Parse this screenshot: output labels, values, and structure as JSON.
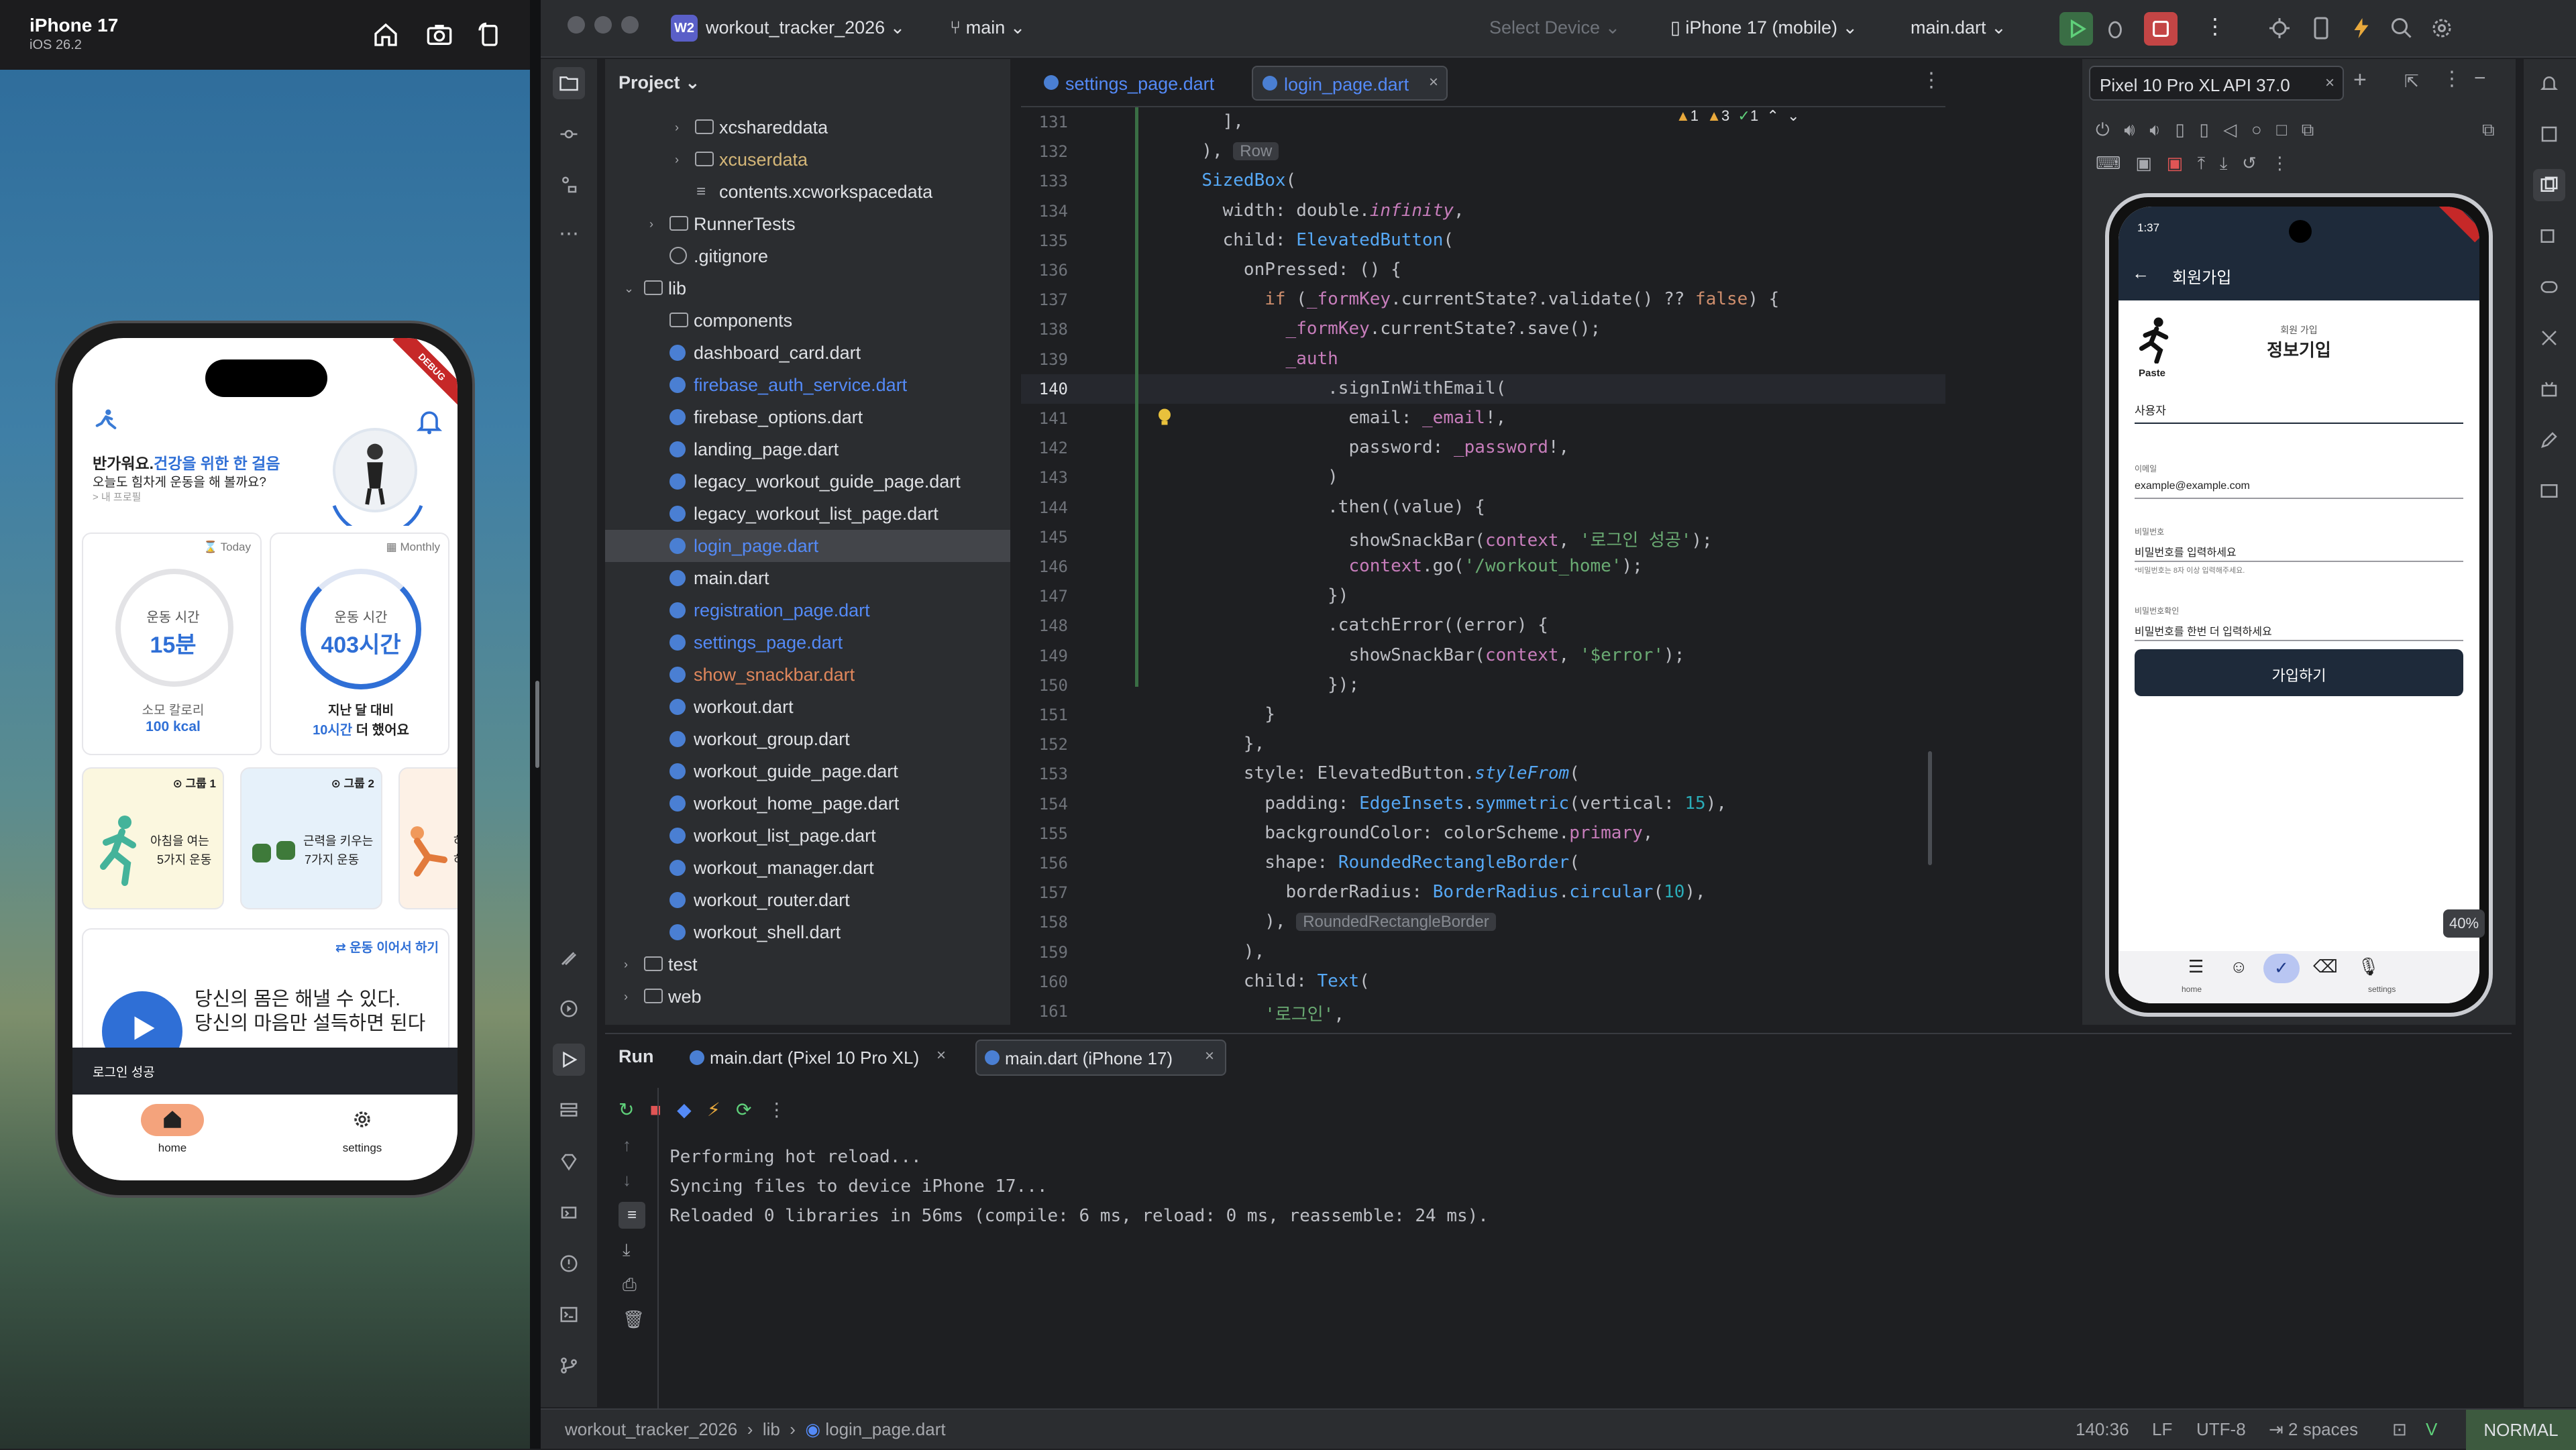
{
  "simulator": {
    "device_name": "iPhone 17",
    "os_version": "iOS 26.2",
    "buttons": [
      "home-icon",
      "screenshot-icon",
      "rotate-icon"
    ],
    "app": {
      "debug_ribbon": "DEBUG",
      "greeting_prefix": "반가워요.",
      "greeting_highlight": "건강을 위한 한 걸음",
      "greeting_sub": "오늘도 힘차게 운동을 해 볼까요?",
      "profile_link": "> 내 프로필",
      "today_card": {
        "tag": "Today",
        "ring_label": "운동 시간",
        "ring_value": "15분",
        "caption": "소모 칼로리",
        "caption_value": "100 kcal"
      },
      "monthly_card": {
        "tag": "Monthly",
        "ring_label": "운동 시간",
        "ring_value": "403시간",
        "caption": "지난 달 대비",
        "caption_value_highlight": "10시간",
        "caption_value_rest": "더 했어요"
      },
      "groups": [
        {
          "title": "그룹 1",
          "line1": "아침을 여는",
          "line2": "5가지 운동"
        },
        {
          "title": "그룹 2",
          "line1": "근력을 키우는",
          "line2": "7가지 운동"
        },
        {
          "title": "",
          "line1": "하",
          "line2": "하"
        }
      ],
      "continue_link": "운동 이어서 하기",
      "quote_line1": "당신의 몸은 해낼 수 있다.",
      "quote_line2": "당신의 마음만 설득하면 된다",
      "snackbar": "로그인 성공",
      "nav": [
        {
          "label": "home",
          "icon": "home-icon"
        },
        {
          "label": "settings",
          "icon": "gear-icon"
        }
      ]
    }
  },
  "ide": {
    "project_badge": "W2",
    "project_name": "workout_tracker_2026",
    "branch": "main",
    "select_device": "Select Device",
    "device": "iPhone 17 (mobile)",
    "run_config": "main.dart",
    "project_panel_title": "Project",
    "tree": [
      {
        "label": "xcshareddata",
        "kind": "folder",
        "depth": 3,
        "color": "#dfe1e5",
        "chev": "›"
      },
      {
        "label": "xcuserdata",
        "kind": "folder",
        "depth": 3,
        "color": "#d5b778",
        "chev": "›"
      },
      {
        "label": "contents.xcworkspacedata",
        "kind": "doc",
        "depth": 3,
        "color": "#dfe1e5",
        "chev": ""
      },
      {
        "label": "RunnerTests",
        "kind": "folder",
        "depth": 2,
        "color": "#dfe1e5",
        "chev": "›"
      },
      {
        "label": ".gitignore",
        "kind": "ignore",
        "depth": 2,
        "color": "#dfe1e5",
        "chev": ""
      },
      {
        "label": "lib",
        "kind": "folder",
        "depth": 1,
        "color": "#dfe1e5",
        "chev": "⌄"
      },
      {
        "label": "components",
        "kind": "folder",
        "depth": 2,
        "color": "#dfe1e5",
        "chev": ""
      },
      {
        "label": "dashboard_card.dart",
        "kind": "dart",
        "depth": 2,
        "color": "#dfe1e5",
        "chev": ""
      },
      {
        "label": "firebase_auth_service.dart",
        "kind": "dart",
        "depth": 2,
        "color": "#548af7",
        "chev": ""
      },
      {
        "label": "firebase_options.dart",
        "kind": "dart",
        "depth": 2,
        "color": "#dfe1e5",
        "chev": ""
      },
      {
        "label": "landing_page.dart",
        "kind": "dart",
        "depth": 2,
        "color": "#dfe1e5",
        "chev": ""
      },
      {
        "label": "legacy_workout_guide_page.dart",
        "kind": "dart",
        "depth": 2,
        "color": "#dfe1e5",
        "chev": ""
      },
      {
        "label": "legacy_workout_list_page.dart",
        "kind": "dart",
        "depth": 2,
        "color": "#dfe1e5",
        "chev": ""
      },
      {
        "label": "login_page.dart",
        "kind": "dart",
        "depth": 2,
        "color": "#548af7",
        "chev": "",
        "selected": true
      },
      {
        "label": "main.dart",
        "kind": "dart",
        "depth": 2,
        "color": "#dfe1e5",
        "chev": ""
      },
      {
        "label": "registration_page.dart",
        "kind": "dart",
        "depth": 2,
        "color": "#548af7",
        "chev": ""
      },
      {
        "label": "settings_page.dart",
        "kind": "dart",
        "depth": 2,
        "color": "#548af7",
        "chev": ""
      },
      {
        "label": "show_snackbar.dart",
        "kind": "dart",
        "depth": 2,
        "color": "#e0875c",
        "chev": ""
      },
      {
        "label": "workout.dart",
        "kind": "dart",
        "depth": 2,
        "color": "#dfe1e5",
        "chev": ""
      },
      {
        "label": "workout_group.dart",
        "kind": "dart",
        "depth": 2,
        "color": "#dfe1e5",
        "chev": ""
      },
      {
        "label": "workout_guide_page.dart",
        "kind": "dart",
        "depth": 2,
        "color": "#dfe1e5",
        "chev": ""
      },
      {
        "label": "workout_home_page.dart",
        "kind": "dart",
        "depth": 2,
        "color": "#dfe1e5",
        "chev": ""
      },
      {
        "label": "workout_list_page.dart",
        "kind": "dart",
        "depth": 2,
        "color": "#dfe1e5",
        "chev": ""
      },
      {
        "label": "workout_manager.dart",
        "kind": "dart",
        "depth": 2,
        "color": "#dfe1e5",
        "chev": ""
      },
      {
        "label": "workout_router.dart",
        "kind": "dart",
        "depth": 2,
        "color": "#dfe1e5",
        "chev": ""
      },
      {
        "label": "workout_shell.dart",
        "kind": "dart",
        "depth": 2,
        "color": "#dfe1e5",
        "chev": ""
      },
      {
        "label": "test",
        "kind": "folder",
        "depth": 1,
        "color": "#dfe1e5",
        "chev": "›"
      },
      {
        "label": "web",
        "kind": "folder",
        "depth": 1,
        "color": "#dfe1e5",
        "chev": "›"
      }
    ],
    "editor_tabs": [
      {
        "label": "settings_page.dart",
        "active": false
      },
      {
        "label": "login_page.dart",
        "active": true
      }
    ],
    "inspections": {
      "warnings_a": "1",
      "warnings_b": "3",
      "ok": "1"
    },
    "current_line": "140",
    "code": [
      {
        "n": "131",
        "html": "    <span class='p'>],</span>"
      },
      {
        "n": "132",
        "html": "  <span class='p'>),</span> <span class='hint'>Row</span>"
      },
      {
        "n": "133",
        "html": "  <span class='t'>SizedBox</span><span class='p'>(</span>"
      },
      {
        "n": "134",
        "html": "    <span class='p'>width: double.</span><span class='f it'>infinity</span><span class='p'>,</span>"
      },
      {
        "n": "135",
        "html": "    <span class='p'>child: </span><span class='t'>ElevatedButton</span><span class='p'>(</span>"
      },
      {
        "n": "136",
        "html": "      <span class='p'>onPressed: () {</span>"
      },
      {
        "n": "137",
        "html": "        <span class='k'>if</span> <span class='p'>(</span><span class='f'>_formKey</span><span class='p'>.currentState?.validate() ?? </span><span class='k'>false</span><span class='p'>) {</span>"
      },
      {
        "n": "138",
        "html": "          <span class='f'>_formKey</span><span class='p'>.currentState?.save();</span>"
      },
      {
        "n": "139",
        "html": "          <span class='f'>_auth</span>"
      },
      {
        "n": "140",
        "html": "              <span class='p'>.signInWithEmail(</span>"
      },
      {
        "n": "141",
        "html": "                <span class='p'>email: </span><span class='f'>_email</span><span class='p'>!,</span>"
      },
      {
        "n": "142",
        "html": "                <span class='p'>password: </span><span class='f'>_password</span><span class='p'>!,</span>"
      },
      {
        "n": "143",
        "html": "              <span class='p'>)</span>"
      },
      {
        "n": "144",
        "html": "              <span class='p'>.then((value) {</span>"
      },
      {
        "n": "145",
        "html": "                <span class='p'>showSnackBar(</span><span class='f'>context</span><span class='p'>, </span><span class='s'>'로그인 성공'</span><span class='p'>);</span>"
      },
      {
        "n": "146",
        "html": "                <span class='f'>context</span><span class='p'>.go(</span><span class='s'>'/workout_home'</span><span class='p'>);</span>"
      },
      {
        "n": "147",
        "html": "              <span class='p'>})</span>"
      },
      {
        "n": "148",
        "html": "              <span class='p'>.catchError((error) {</span>"
      },
      {
        "n": "149",
        "html": "                <span class='p'>showSnackBar(</span><span class='f'>context</span><span class='p'>, </span><span class='s'>'$error'</span><span class='p'>);</span>"
      },
      {
        "n": "150",
        "html": "              <span class='p'>});</span>"
      },
      {
        "n": "151",
        "html": "        <span class='p'>}</span>"
      },
      {
        "n": "152",
        "html": "      <span class='p'>},</span>"
      },
      {
        "n": "153",
        "html": "      <span class='p'>style: ElevatedButton.</span><span class='t it'>styleFrom</span><span class='p'>(</span>"
      },
      {
        "n": "154",
        "html": "        <span class='p'>padding: </span><span class='t'>EdgeInsets</span><span class='p'>.</span><span class='t'>symmetric</span><span class='p'>(vertical: </span><span class='g'>15</span><span class='p'>),</span>"
      },
      {
        "n": "155",
        "html": "        <span class='p'>backgroundColor: colorScheme.</span><span class='f'>primary</span><span class='p'>,</span>"
      },
      {
        "n": "156",
        "html": "        <span class='p'>shape: </span><span class='t'>RoundedRectangleBorder</span><span class='p'>(</span>"
      },
      {
        "n": "157",
        "html": "          <span class='p'>borderRadius: </span><span class='t'>BorderRadius</span><span class='p'>.</span><span class='t'>circular</span><span class='p'>(</span><span class='g'>10</span><span class='p'>),</span>"
      },
      {
        "n": "158",
        "html": "        <span class='p'>),</span> <span class='hint'>RoundedRectangleBorder</span>"
      },
      {
        "n": "159",
        "html": "      <span class='p'>),</span>"
      },
      {
        "n": "160",
        "html": "      <span class='p'>child: </span><span class='t'>Text</span><span class='p'>(</span>"
      },
      {
        "n": "161",
        "html": "        <span class='s'>'로그인'</span><span class='p'>,</span>"
      }
    ],
    "device_tab": "Pixel 10 Pro XL API 37.0",
    "avd": {
      "time": "1:37",
      "appbar_title": "회원가입",
      "paste": "Paste",
      "header_small": "회원 가입",
      "header_title": "정보기입",
      "fields": [
        {
          "label": "사용자",
          "value": "",
          "helper": ""
        },
        {
          "label": "이메일",
          "value": "example@example.com",
          "helper": ""
        },
        {
          "label": "비밀번호",
          "value": "비밀번호를 입력하세요",
          "helper": "*비밀번호는 8자 이상 입력해주세요."
        },
        {
          "label": "비밀번호확인",
          "value": "비밀번호를 한번 더 입력하세요",
          "helper": ""
        }
      ],
      "submit": "가입하기",
      "kb_home": "home",
      "kb_settings": "settings",
      "zoom": "40%"
    },
    "run": {
      "title": "Run",
      "tabs": [
        {
          "label": "main.dart (Pixel 10 Pro XL)",
          "active": false
        },
        {
          "label": "main.dart (iPhone 17)",
          "active": true
        }
      ],
      "console": [
        "Performing hot reload...",
        "Syncing files to device iPhone 17...",
        "Reloaded 0 libraries in 56ms (compile: 6 ms, reload: 0 ms, reassemble: 24 ms)."
      ]
    },
    "status": {
      "crumb_project": "workout_tracker_2026",
      "crumb_dir": "lib",
      "crumb_file": "login_page.dart",
      "position": "140:36",
      "line_sep": "LF",
      "encoding": "UTF-8",
      "indent": "2 spaces",
      "mode": "NORMAL"
    }
  }
}
